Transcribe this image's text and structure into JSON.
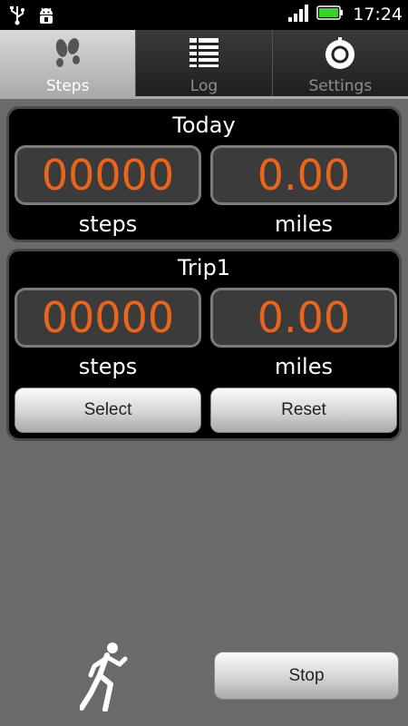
{
  "status_bar": {
    "time": "17:24",
    "icons": [
      "usb-icon",
      "android-debug-icon",
      "signal-icon",
      "battery-icon"
    ]
  },
  "tabs": [
    {
      "label": "Steps",
      "icon": "footprints-icon",
      "active": true
    },
    {
      "label": "Log",
      "icon": "log-list-icon",
      "active": false
    },
    {
      "label": "Settings",
      "icon": "settings-knob-icon",
      "active": false
    }
  ],
  "today": {
    "title": "Today",
    "steps_value": "00000",
    "miles_value": "0.00",
    "steps_label": "steps",
    "miles_label": "miles"
  },
  "trip": {
    "title": "Trip1",
    "steps_value": "00000",
    "miles_value": "0.00",
    "steps_label": "steps",
    "miles_label": "miles",
    "select_label": "Select",
    "reset_label": "Reset"
  },
  "footer": {
    "stop_label": "Stop",
    "runner_icon": "runner-icon"
  },
  "colors": {
    "accent": "#e9651d",
    "background": "#6a6a6a",
    "panel": "#000000"
  }
}
